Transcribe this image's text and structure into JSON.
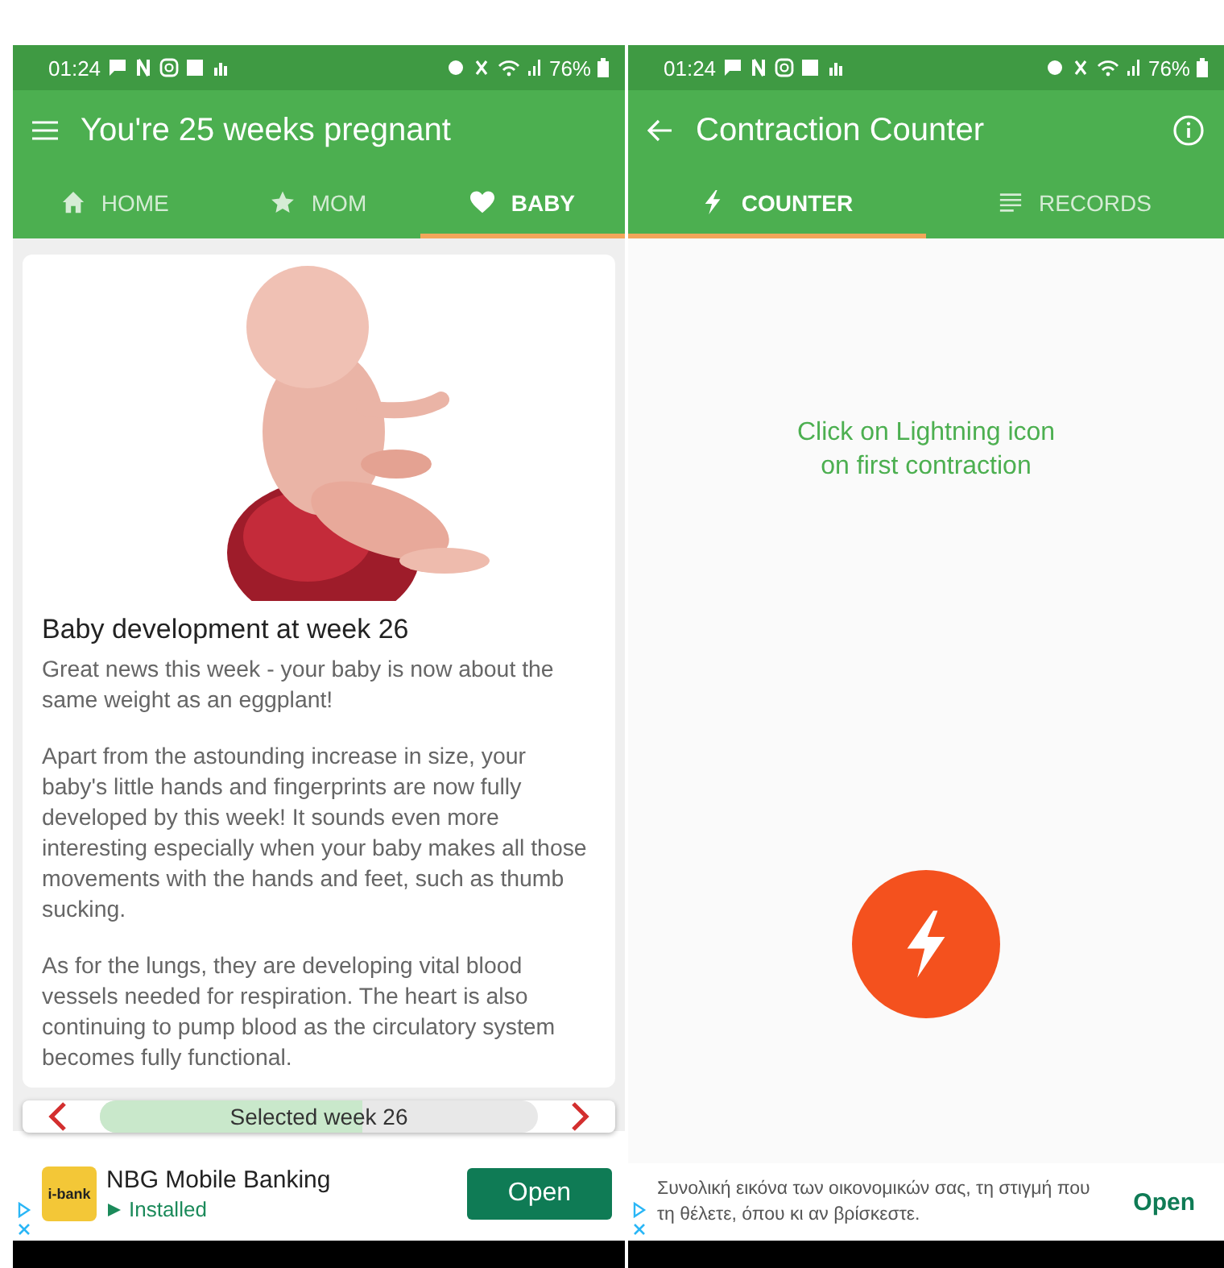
{
  "screens": [
    {
      "kind": "week",
      "status_bar": {
        "time": "01:24",
        "battery": "76%"
      },
      "title": "You're 25 weeks pregnant",
      "tabs": [
        {
          "label": "HOME",
          "selected": false
        },
        {
          "label": "MOM",
          "selected": false
        },
        {
          "label": "BABY",
          "selected": true
        }
      ],
      "article": {
        "heading": "Baby development at week 26",
        "paragraphs": [
          "Great news this week - your baby is now about the same weight as an eggplant!",
          "Apart from the astounding increase in size, your baby's little hands and fingerprints are now fully developed by this week! It sounds even more interesting especially when your baby makes all those movements with the hands and feet, such as thumb sucking.",
          "As for the lungs, they are developing vital blood vessels needed for respiration. The heart is also continuing to pump blood as the circulatory system becomes fully functional."
        ]
      },
      "week_selector": {
        "label": "Selected week 26",
        "level": 0.6
      },
      "ad": {
        "logo": "i-bank",
        "title": "NBG Mobile Banking",
        "subtitle": "Installed",
        "button": "Open"
      }
    },
    {
      "kind": "counter",
      "status_bar": {
        "time": "01:24",
        "battery": "76%"
      },
      "title": "Contraction Counter",
      "tabs": [
        {
          "label": "COUNTER",
          "selected": true
        },
        {
          "label": "RECORDS",
          "selected": false
        }
      ],
      "hint": "Click on Lightning icon\non first contraction",
      "ad": {
        "text": "Συνολική εικόνα των οικονομικών σας, τη στιγμή που τη θέλετε, όπου κι αν βρίσκεστε.",
        "button": "Open"
      }
    }
  ]
}
